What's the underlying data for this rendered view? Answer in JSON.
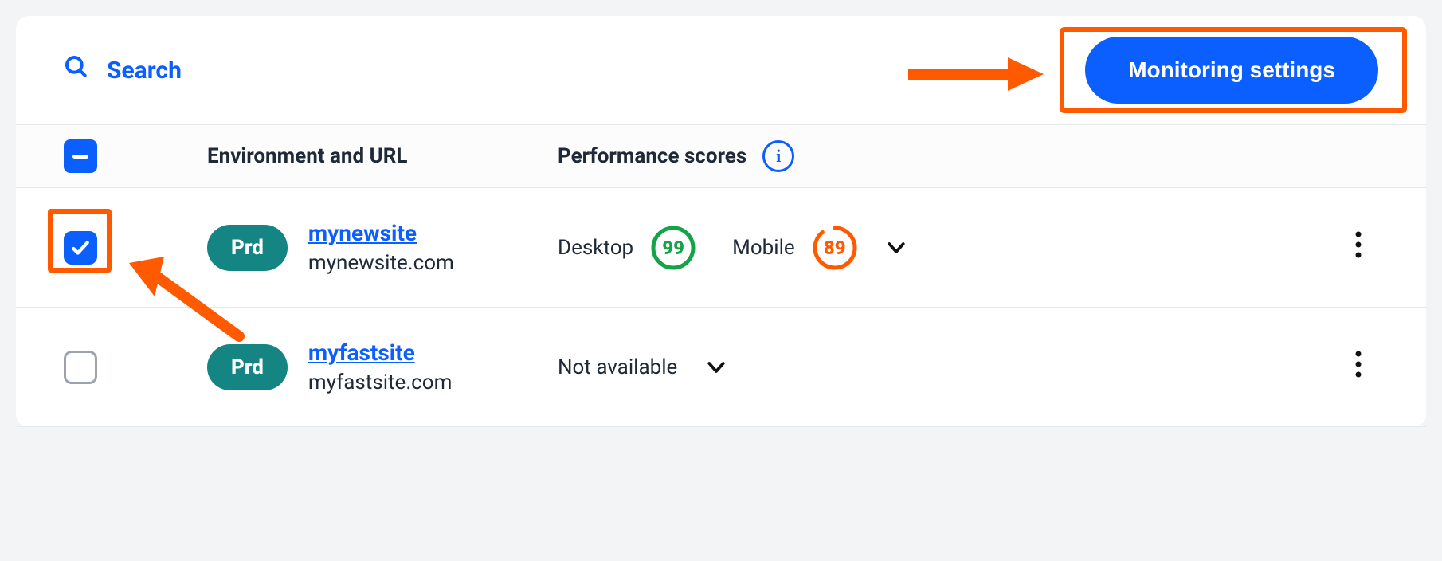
{
  "colors": {
    "accent": "#0b5fff",
    "callout": "#ff5a00",
    "badge": "#158583",
    "score_good": "#15a34a",
    "score_warn": "#ff5a00"
  },
  "header": {
    "search_placeholder": "Search",
    "monitoring_button": "Monitoring settings"
  },
  "columns": {
    "env": "Environment and URL",
    "perf": "Performance scores"
  },
  "select_all_state": "indeterminate",
  "rows": [
    {
      "checked": true,
      "highlighted": true,
      "badge": "Prd",
      "name": "mynewsite",
      "domain": "mynewsite.com",
      "perf": {
        "available": true,
        "desktop_label": "Desktop",
        "desktop_score": "99",
        "mobile_label": "Mobile",
        "mobile_score": "89"
      }
    },
    {
      "checked": false,
      "highlighted": false,
      "badge": "Prd",
      "name": "myfastsite",
      "domain": "myfastsite.com",
      "perf": {
        "available": false,
        "na_label": "Not available"
      }
    }
  ]
}
